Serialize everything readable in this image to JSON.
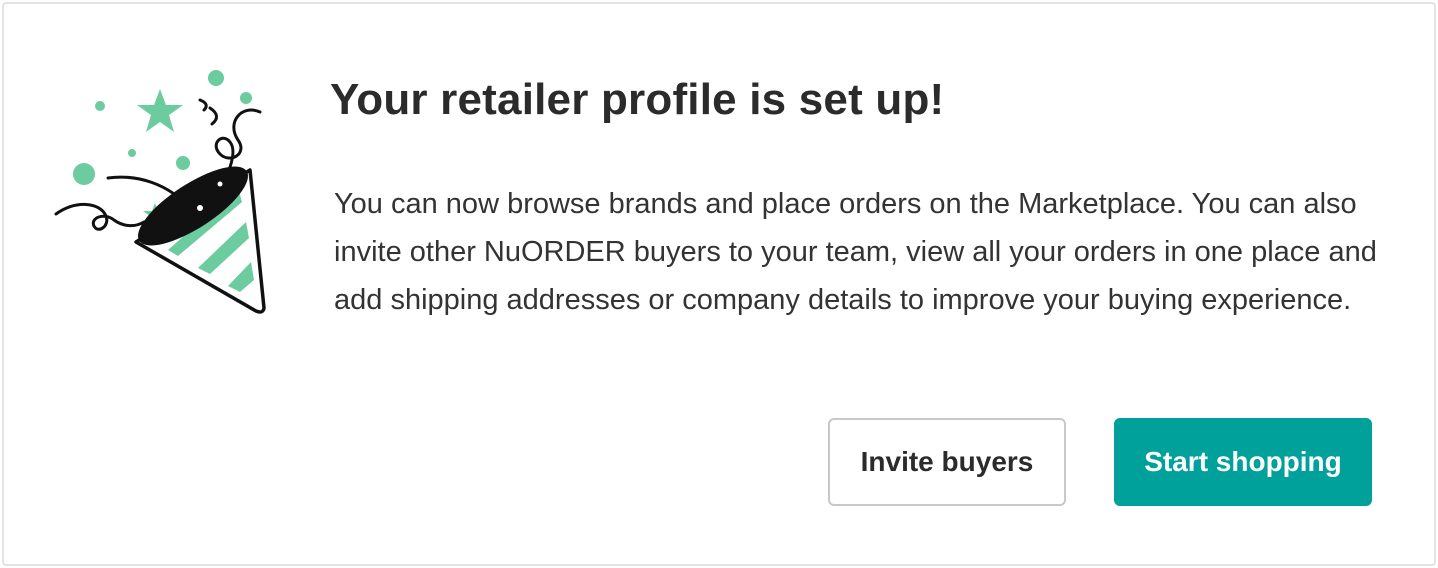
{
  "card": {
    "title": "Your retailer profile is set up!",
    "body": "You can now browse brands and place orders on the Marketplace. You can also invite other NuORDER buyers to your team, view all your orders in one place and add shipping addresses or company details to improve your buying experience.",
    "illustration": "party-popper-icon"
  },
  "actions": {
    "secondary_label": "Invite buyers",
    "primary_label": "Start shopping"
  },
  "colors": {
    "accent": "#00a19a",
    "confetti": "#6ccb9f",
    "text": "#2b2b2b",
    "border": "#e3e3e3"
  }
}
